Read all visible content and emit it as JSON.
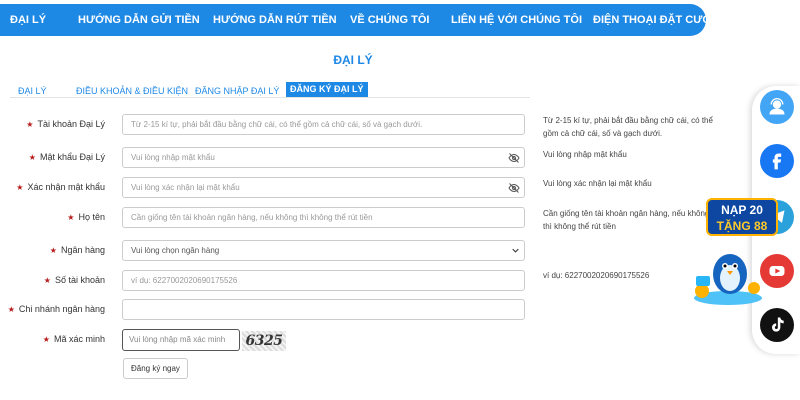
{
  "nav": {
    "items": [
      "ĐẠI LÝ",
      "HƯỚNG DẪN GỬI TIỀN",
      "HƯỚNG DẪN RÚT TIỀN",
      "VỀ CHÚNG TÔI",
      "LIÊN HỆ VỚI CHÚNG TÔI",
      "ĐIỆN THOẠI ĐẶT CƯỢC"
    ]
  },
  "page_title": "ĐẠI LÝ",
  "tabs": [
    "ĐẠI LÝ",
    "ĐIỀU KHOẢN & ĐIỀU KIỆN",
    "ĐĂNG NHẬP ĐẠI LÝ",
    "ĐĂNG KÝ ĐẠI LÝ"
  ],
  "active_tab": "ĐĂNG KÝ ĐẠI LÝ",
  "form": {
    "account": {
      "label": "Tài khoản Đại Lý",
      "placeholder": "Từ 2-15 kí tự, phải bắt đầu bằng chữ cái, có thể  gồm cả chữ cái, số và gạch dưới.",
      "hint": "Từ 2-15 kí tự, phải bắt đầu bằng chữ cái, có thể gồm cả chữ cái, số và gạch dưới."
    },
    "password": {
      "label": "Mật khẩu Đại Lý",
      "placeholder": "Vui lòng nhập mật khẩu",
      "hint": "Vui lòng nhập mật khẩu"
    },
    "confirm_password": {
      "label": "Xác nhận mật khẩu",
      "placeholder": "Vui lòng xác nhận lại mật khẩu",
      "hint": "Vui lòng xác nhận lại mật khẩu"
    },
    "full_name": {
      "label": "Họ tên",
      "placeholder": "Cần giống tên tài khoản ngân hàng, nếu không thì không thể rút tiền",
      "hint": "Cần giống tên tài khoản ngân hàng, nếu không thì không thể rút tiền"
    },
    "bank": {
      "label": "Ngân hàng",
      "selected": "Vui lòng chọn ngân hàng"
    },
    "account_number": {
      "label": "Số tài khoản",
      "placeholder": "ví dụ:  6227002020690175526",
      "hint": "ví dụ:  6227002020690175526"
    },
    "branch": {
      "label": "Chi nhánh ngân hàng",
      "placeholder": ""
    },
    "captcha": {
      "label": "Mã xác minh",
      "placeholder": "Vui lòng nhập mã xác minh",
      "code": "6325"
    },
    "submit_label": "Đăng ký ngay"
  },
  "side_icons": [
    "support-agent-icon",
    "facebook-icon",
    "telegram-icon",
    "youtube-icon",
    "tiktok-icon"
  ],
  "promo": {
    "line1": "NẠP 20",
    "line2": "TẶNG 88"
  },
  "colors": {
    "primary": "#1e88e5",
    "required_star": "#b71c1c",
    "facebook": "#1877f2",
    "telegram": "#2aa1da",
    "youtube": "#e53935"
  }
}
